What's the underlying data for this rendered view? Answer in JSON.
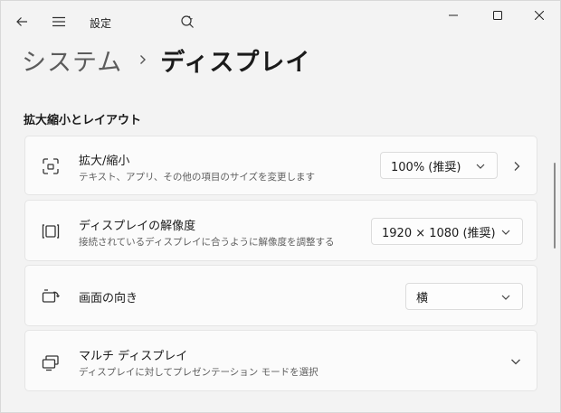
{
  "titlebar": {
    "title": "設定"
  },
  "header": {
    "parent": "システム",
    "current": "ディスプレイ"
  },
  "section": {
    "title": "拡大縮小とレイアウト"
  },
  "cards": {
    "scale": {
      "title": "拡大/縮小",
      "desc": "テキスト、アプリ、その他の項目のサイズを変更します",
      "value": "100% (推奨)",
      "icon": "scale-icon"
    },
    "resolution": {
      "title": "ディスプレイの解像度",
      "desc": "接続されているディスプレイに合うように解像度を調整する",
      "value": "1920 × 1080 (推奨)",
      "icon": "resolution-icon"
    },
    "orientation": {
      "title": "画面の向き",
      "value": "横",
      "icon": "orientation-icon"
    },
    "multi": {
      "title": "マルチ ディスプレイ",
      "desc": "ディスプレイに対してプレゼンテーション モードを選択",
      "icon": "multi-display-icon"
    }
  }
}
